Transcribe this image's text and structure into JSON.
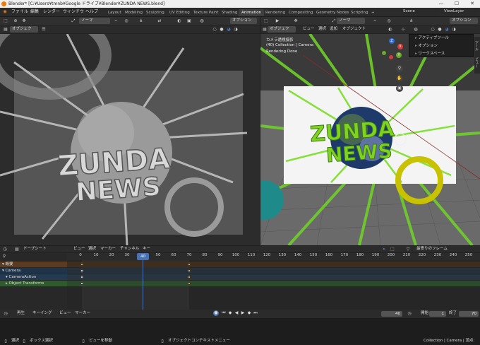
{
  "window": {
    "title": "Blender* [C:¥Users¥tmnb¥Google ドライブ¥Blender¥ZUNDA NEWS.blend]",
    "minimize": "—",
    "maximize": "☐",
    "close": "✕"
  },
  "menu": {
    "items": [
      "ファイル",
      "編集",
      "レンダー",
      "ウィンドウ",
      "ヘルプ"
    ]
  },
  "workspaces": {
    "tabs": [
      "Layout",
      "Modeling",
      "Sculpting",
      "UV Editing",
      "Texture Paint",
      "Shading",
      "Animation",
      "Rendering",
      "Compositing",
      "Geometry Nodes",
      "Scripting"
    ],
    "active": "Animation",
    "add": "+"
  },
  "scene": {
    "name": "Scene",
    "view_layer": "ViewLayer"
  },
  "left_viewport": {
    "mode": "オブジェク",
    "normal": "ノーマ",
    "options": "オプション",
    "text_line1": "ZUNDA",
    "text_line2": "NEWS"
  },
  "right_viewport": {
    "mode": "オブジェク",
    "menus": [
      "ビュー",
      "選択",
      "追加",
      "オブジェクト"
    ],
    "normal": "ノーマ",
    "options": "オプション",
    "camera_label": "カメラ透視投影",
    "collection_label": "(40) Collection | Camera",
    "render_status": "Rendering Done",
    "text_line1": "ZUNDA",
    "text_line2": "NEWS",
    "axis": {
      "x": "X",
      "y": "Y",
      "z": "Z"
    }
  },
  "popup": {
    "items": [
      "アクティブツール",
      "オプション",
      "ワークスペース"
    ]
  },
  "side_tabs": [
    "ツール",
    "ビュー"
  ],
  "timeline": {
    "editor": "ドープシート",
    "menus": [
      "ビュー",
      "選択",
      "マーカー",
      "チャンネル",
      "キー"
    ],
    "playhead_label": "最寄りのフレーム",
    "ticks": [
      "0",
      "10",
      "20",
      "30",
      "40",
      "50",
      "60",
      "70",
      "80",
      "90",
      "100",
      "110",
      "120",
      "130",
      "140",
      "150",
      "160",
      "170",
      "180",
      "190",
      "200",
      "210",
      "220",
      "230",
      "240",
      "250"
    ],
    "current_frame": "40",
    "channels": [
      {
        "label": "概要",
        "color": "#5a3a20",
        "icon": "▾"
      },
      {
        "label": "Camera",
        "color": "#1f3448",
        "icon": "▾"
      },
      {
        "label": "CameraAction",
        "color": "#243a50",
        "icon": "▾"
      },
      {
        "label": "Object Transforms",
        "color": "#2e5a2e",
        "icon": "▸"
      }
    ]
  },
  "playback": {
    "playback": "再生",
    "keying": "キーイング",
    "view": "ビュー",
    "marker": "マーカー",
    "frame": "40",
    "start_label": "開始",
    "start": "1",
    "end_label": "終了",
    "end": "70"
  },
  "status": {
    "select": "選択",
    "box_select": "ボックス選択",
    "move_view": "ビューを移動",
    "context_menu": "オブジェクトコンテキストメニュー",
    "info": "Collection | Camera | 頂点:"
  },
  "colors": {
    "accent": "#e87d0d",
    "selected_frame": "#4b72b0",
    "green": "#7ed321",
    "yellow": "#c8c200"
  }
}
